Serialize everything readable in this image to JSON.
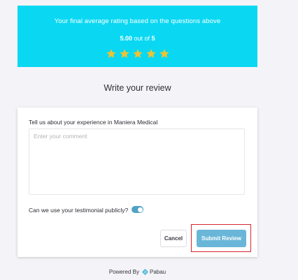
{
  "rating": {
    "caption": "Your final average rating based on the questions above",
    "score": "5.00",
    "out_of_text": "out of",
    "max": "5",
    "stars": [
      {
        "name": "star-1"
      },
      {
        "name": "star-2"
      },
      {
        "name": "star-3"
      },
      {
        "name": "star-4"
      },
      {
        "name": "star-5"
      }
    ],
    "star_count": 5,
    "star_color": "#f2c230",
    "banner_color": "#0ad8f2"
  },
  "review": {
    "title": "Write your review",
    "field_label": "Tell us about your experience in Maniera Medical",
    "comment_placeholder": "Enter your comment",
    "public_label": "Can we use your testimonial publicly?",
    "public_enabled": true
  },
  "actions": {
    "cancel_label": "Cancel",
    "submit_label": "Submit Review",
    "submit_color": "#6ab6d8",
    "highlight_color": "#d8252f"
  },
  "footer": {
    "powered_by": "Powered By",
    "brand": "Pabau",
    "brand_icon": "pabau-logo-icon"
  }
}
